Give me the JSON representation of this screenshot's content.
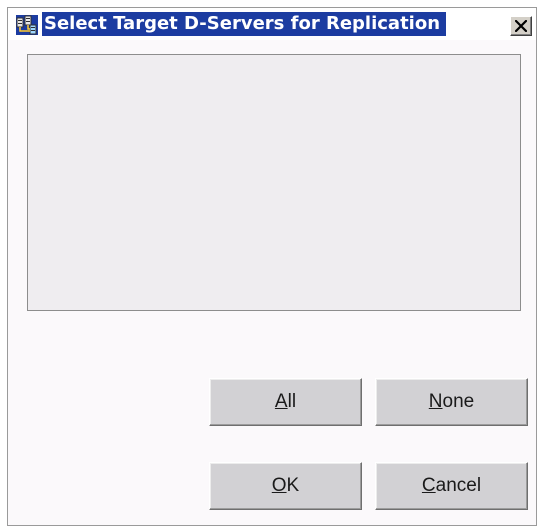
{
  "window": {
    "title": "Select Target D-Servers for Replication",
    "title_icon": "server-network-icon",
    "close_icon": "close-x-icon"
  },
  "server_list": {
    "items": []
  },
  "buttons": {
    "all": {
      "mnemonic": "A",
      "rest": "ll"
    },
    "none": {
      "mnemonic": "N",
      "rest": "one"
    },
    "ok": {
      "mnemonic": "O",
      "rest": "K"
    },
    "cancel": {
      "mnemonic": "C",
      "rest": "ancel"
    }
  },
  "colors": {
    "title_background": "#1c3ca1",
    "title_text": "#ffffff",
    "dialog_background": "#fbf9fb",
    "list_background": "#efedf0",
    "button_face": "#d2d1d4"
  }
}
